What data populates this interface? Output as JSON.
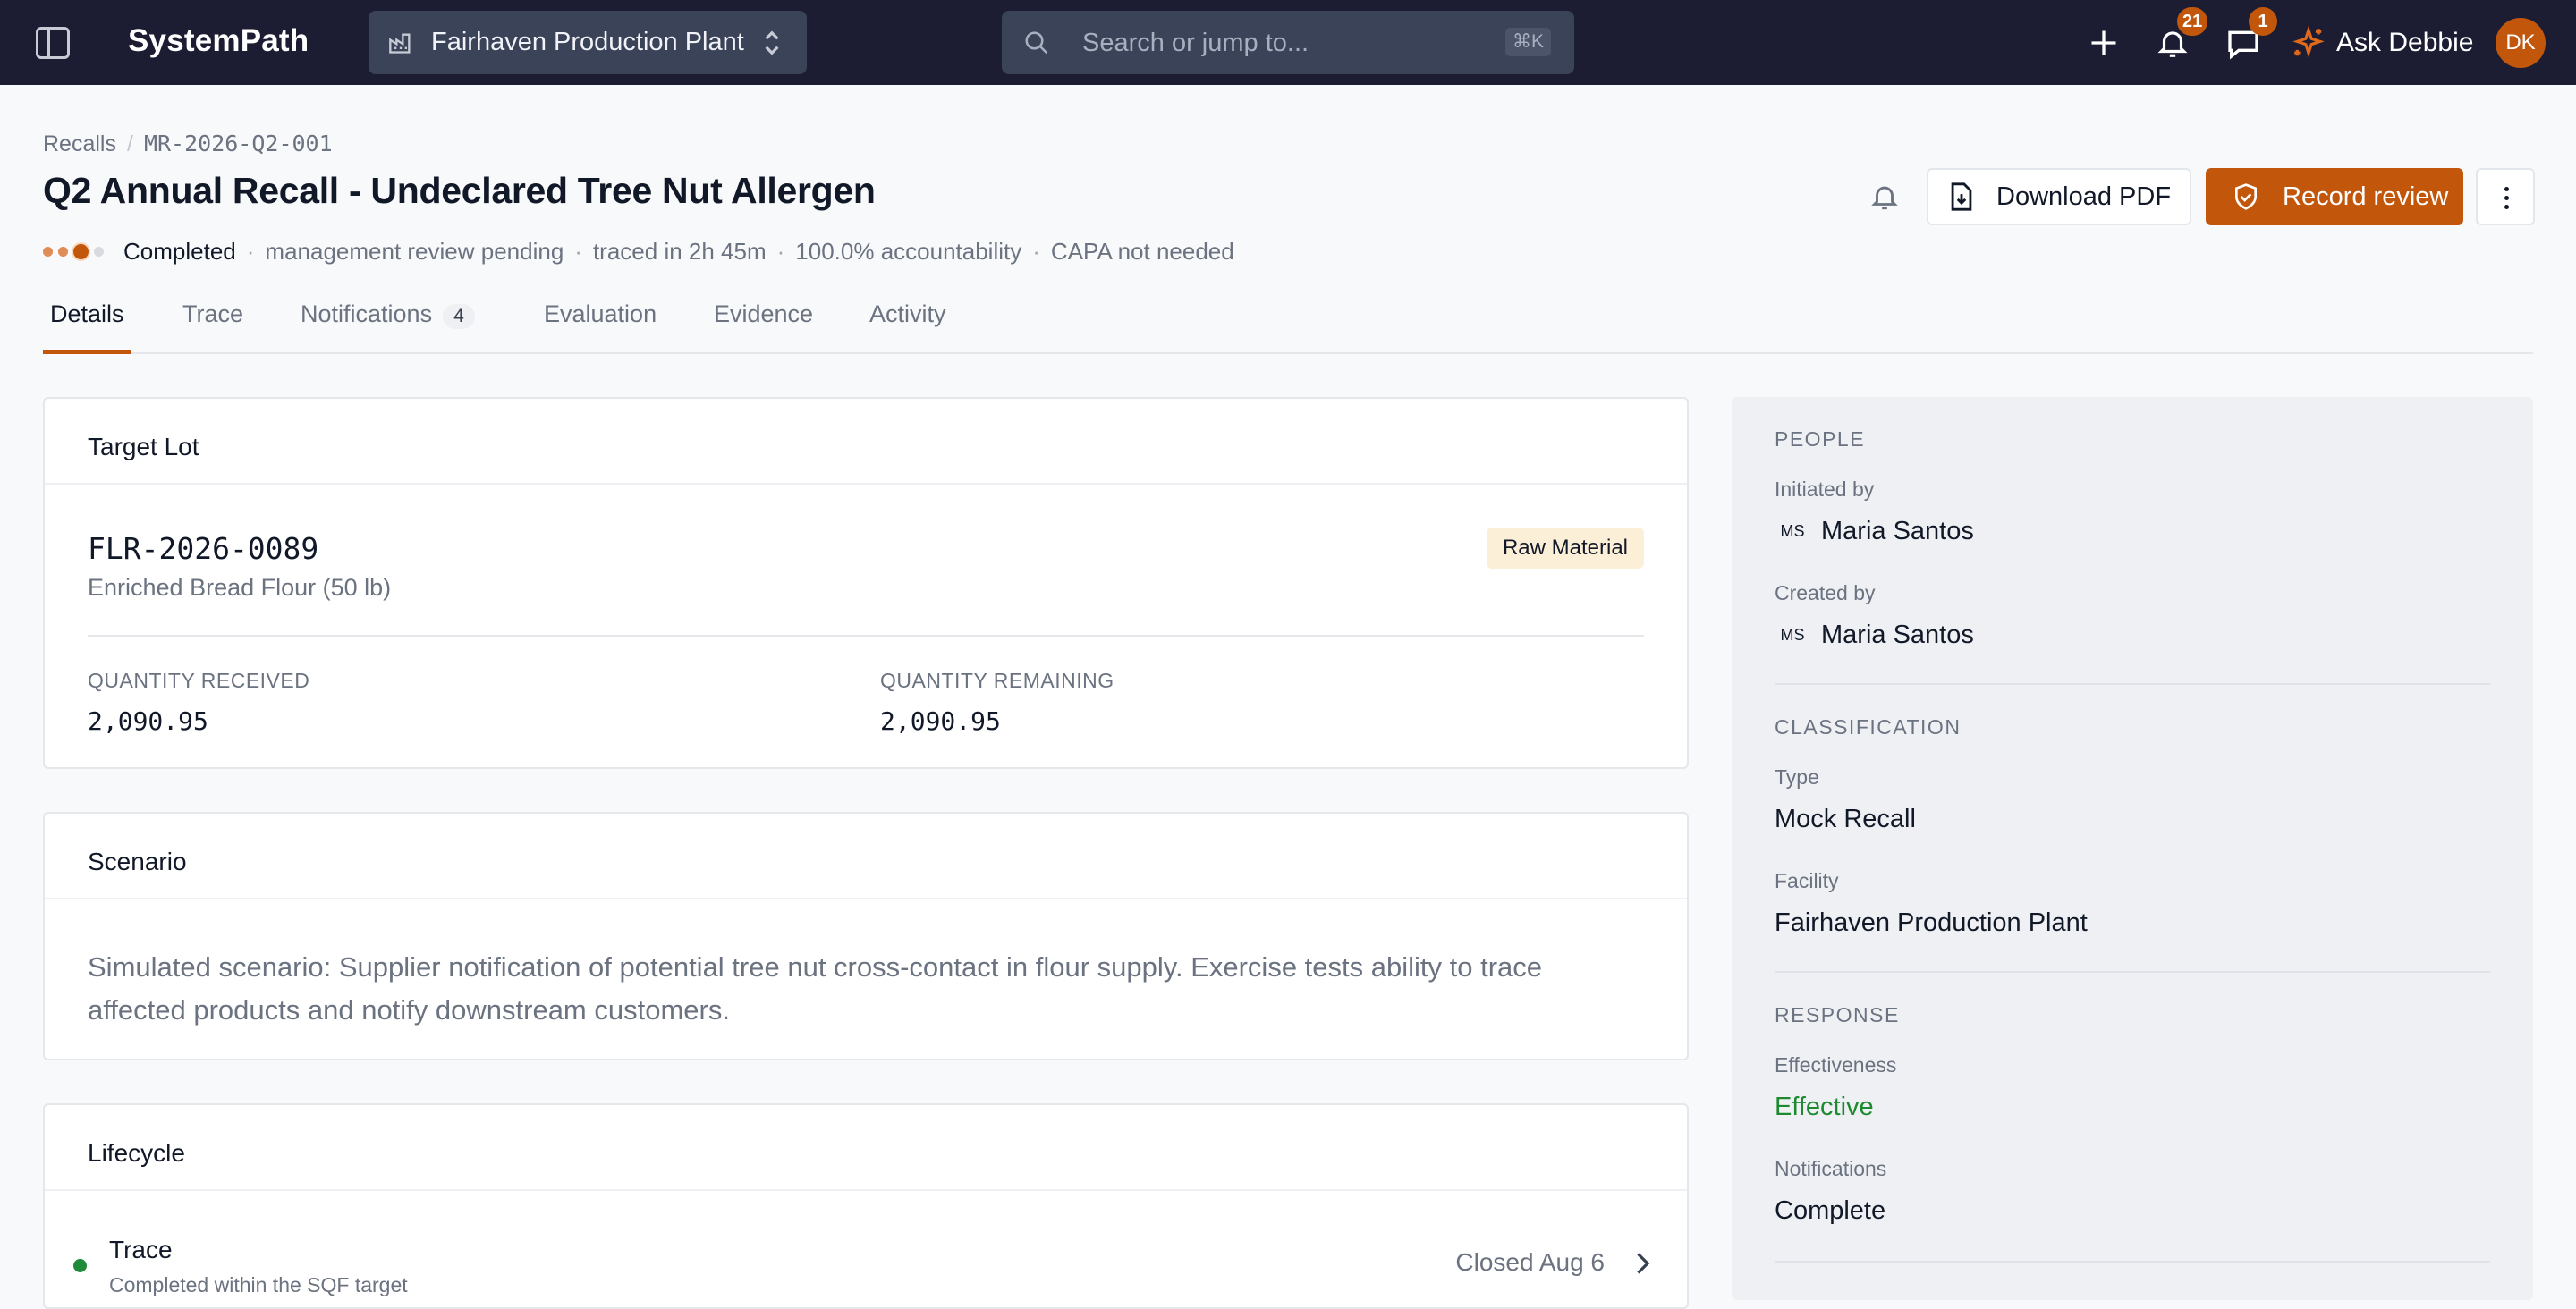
{
  "topbar": {
    "brand": "SystemPath",
    "facility": "Fairhaven Production Plant",
    "search_placeholder": "Search or jump to...",
    "search_shortcut": "⌘K",
    "notifications_count": "21",
    "messages_count": "1",
    "ask_label": "Ask Debbie",
    "user_initials": "DK"
  },
  "breadcrumb": {
    "root": "Recalls",
    "current": "MR-2026-Q2-001"
  },
  "header": {
    "title": "Q2 Annual Recall - Undeclared Tree Nut Allergen",
    "status": "Completed",
    "meta": [
      "management review pending",
      "traced in 2h 45m",
      "100.0% accountability",
      "CAPA not needed"
    ],
    "download_label": "Download PDF",
    "record_label": "Record review"
  },
  "tabs": [
    {
      "label": "Details"
    },
    {
      "label": "Trace"
    },
    {
      "label": "Notifications",
      "count": "4"
    },
    {
      "label": "Evaluation"
    },
    {
      "label": "Evidence"
    },
    {
      "label": "Activity"
    }
  ],
  "target_lot": {
    "title": "Target Lot",
    "lot_id": "FLR-2026-0089",
    "product": "Enriched Bread Flour (50 lb)",
    "tag": "Raw Material",
    "qty_received_label": "QUANTITY RECEIVED",
    "qty_received": "2,090.95",
    "qty_remaining_label": "QUANTITY REMAINING",
    "qty_remaining": "2,090.95"
  },
  "scenario": {
    "title": "Scenario",
    "text": "Simulated scenario: Supplier notification of potential tree nut cross-contact in flour supply. Exercise tests ability to trace affected products and notify downstream customers."
  },
  "lifecycle": {
    "title": "Lifecycle",
    "step_title": "Trace",
    "step_sub": "Completed within the SQF target",
    "step_closed": "Closed Aug 6"
  },
  "side": {
    "people_heading": "PEOPLE",
    "initiated_label": "Initiated by",
    "initiated_initials": "MS",
    "initiated_name": "Maria Santos",
    "created_label": "Created by",
    "created_initials": "MS",
    "created_name": "Maria Santos",
    "classification_heading": "CLASSIFICATION",
    "type_label": "Type",
    "type_value": "Mock Recall",
    "facility_label": "Facility",
    "facility_value": "Fairhaven Production Plant",
    "response_heading": "RESPONSE",
    "effectiveness_label": "Effectiveness",
    "effectiveness_value": "Effective",
    "notifications_label": "Notifications",
    "notifications_value": "Complete"
  },
  "colors": {
    "topbar": "#1c1d33",
    "accent": "#c2570c",
    "success": "#1e8a2f",
    "tag_bg": "#fcefd8"
  }
}
